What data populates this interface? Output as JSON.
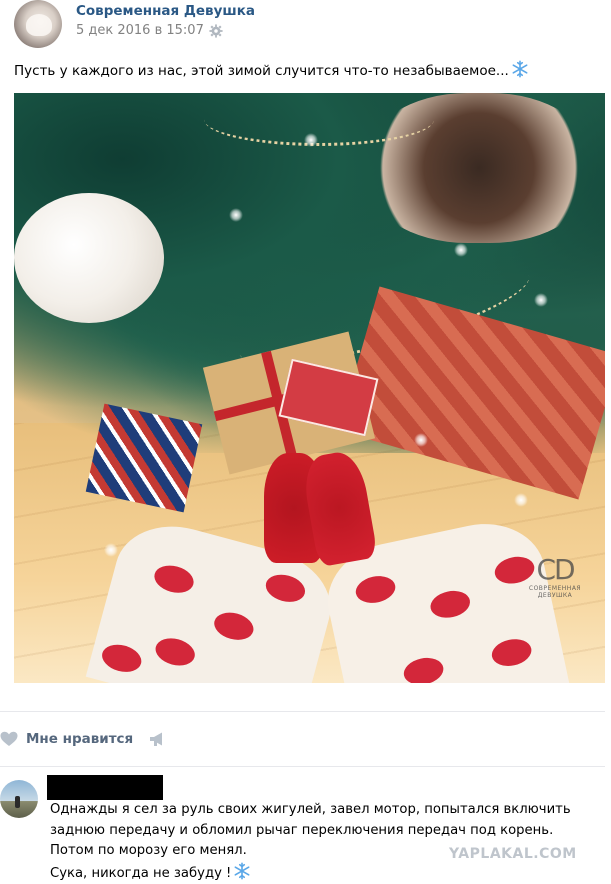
{
  "post": {
    "author": "Современная Девушка",
    "date": "5 дек 2016 в 15:07",
    "text": "Пусть у каждого из нас, этой зимой случится что-то незабываемое...",
    "image_watermark": {
      "mark": "CD",
      "subtitle": "СОВРЕМЕННАЯ ДЕВУШКА"
    }
  },
  "actions": {
    "like_label": "Мне нравится"
  },
  "comment": {
    "lines": [
      "Однажды я сел за руль своих жигулей, завел мотор, попытался включить",
      "заднюю передачу и обломил рычаг переключения передач под корень.",
      "Потом по морозу его менял.",
      "Сука, никогда не забуду !"
    ]
  },
  "site_watermark": "YAPLAKAL.COM",
  "icons": {
    "settings": "gear-icon",
    "emoji": "snowflake-icon",
    "like": "heart-icon",
    "share": "megaphone-icon"
  },
  "colors": {
    "author_link": "#2a5885",
    "meta_gray": "#828282",
    "action_gray": "#55677d",
    "divider": "#e7e8ec",
    "snowflake": "#5aa7e8"
  }
}
